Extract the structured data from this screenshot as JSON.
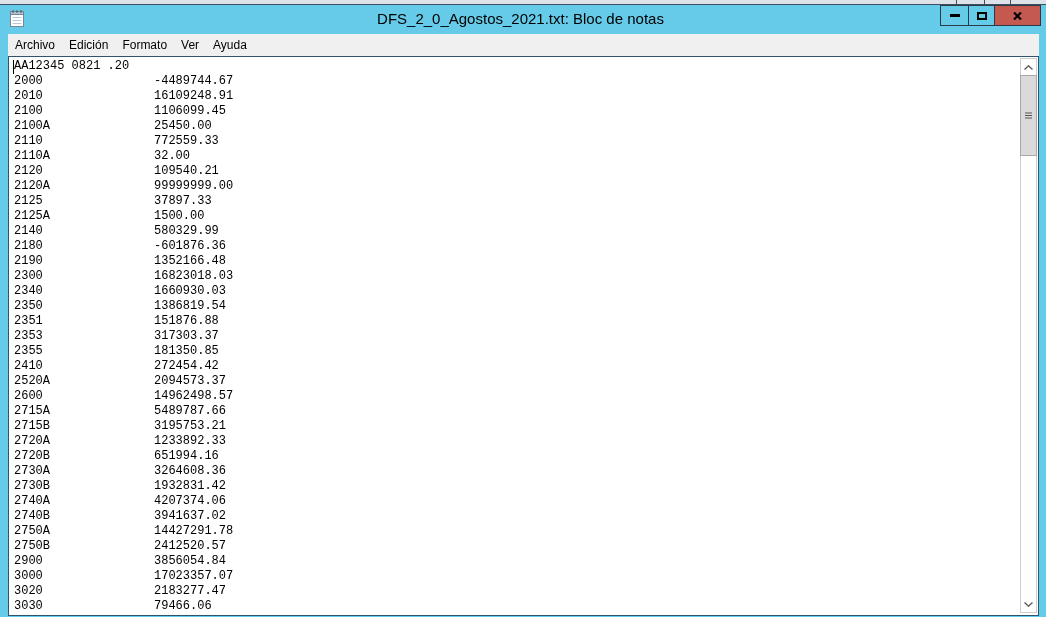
{
  "window": {
    "title": "DFS_2_0_Agostos_2021.txt: Bloc de notas"
  },
  "menu": [
    "Archivo",
    "Edición",
    "Formato",
    "Ver",
    "Ayuda"
  ],
  "document": {
    "header": "AA12345 0821 .20",
    "rows": [
      {
        "code": "2000",
        "value": "-4489744.67"
      },
      {
        "code": "2010",
        "value": "16109248.91"
      },
      {
        "code": "2100",
        "value": "1106099.45"
      },
      {
        "code": "2100A",
        "value": "25450.00"
      },
      {
        "code": "2110",
        "value": "772559.33"
      },
      {
        "code": "2110A",
        "value": "32.00"
      },
      {
        "code": "2120",
        "value": "109540.21"
      },
      {
        "code": "2120A",
        "value": "99999999.00"
      },
      {
        "code": "2125",
        "value": "37897.33"
      },
      {
        "code": "2125A",
        "value": "1500.00"
      },
      {
        "code": "2140",
        "value": "580329.99"
      },
      {
        "code": "2180",
        "value": "-601876.36"
      },
      {
        "code": "2190",
        "value": "1352166.48"
      },
      {
        "code": "2300",
        "value": "16823018.03"
      },
      {
        "code": "2340",
        "value": "1660930.03"
      },
      {
        "code": "2350",
        "value": "1386819.54"
      },
      {
        "code": "2351",
        "value": "151876.88"
      },
      {
        "code": "2353",
        "value": "317303.37"
      },
      {
        "code": "2355",
        "value": "181350.85"
      },
      {
        "code": "2410",
        "value": "272454.42"
      },
      {
        "code": "2520A",
        "value": "2094573.37"
      },
      {
        "code": "2600",
        "value": "14962498.57"
      },
      {
        "code": "2715A",
        "value": "5489787.66"
      },
      {
        "code": "2715B",
        "value": "3195753.21"
      },
      {
        "code": "2720A",
        "value": "1233892.33"
      },
      {
        "code": "2720B",
        "value": "651994.16"
      },
      {
        "code": "2730A",
        "value": "3264608.36"
      },
      {
        "code": "2730B",
        "value": "1932831.42"
      },
      {
        "code": "2740A",
        "value": "4207374.06"
      },
      {
        "code": "2740B",
        "value": "3941637.02"
      },
      {
        "code": "2750A",
        "value": "14427291.78"
      },
      {
        "code": "2750B",
        "value": "2412520.57"
      },
      {
        "code": "2900",
        "value": "3856054.84"
      },
      {
        "code": "3000",
        "value": "17023357.07"
      },
      {
        "code": "3020",
        "value": "2183277.47"
      },
      {
        "code": "3030",
        "value": "79466.06"
      }
    ]
  }
}
